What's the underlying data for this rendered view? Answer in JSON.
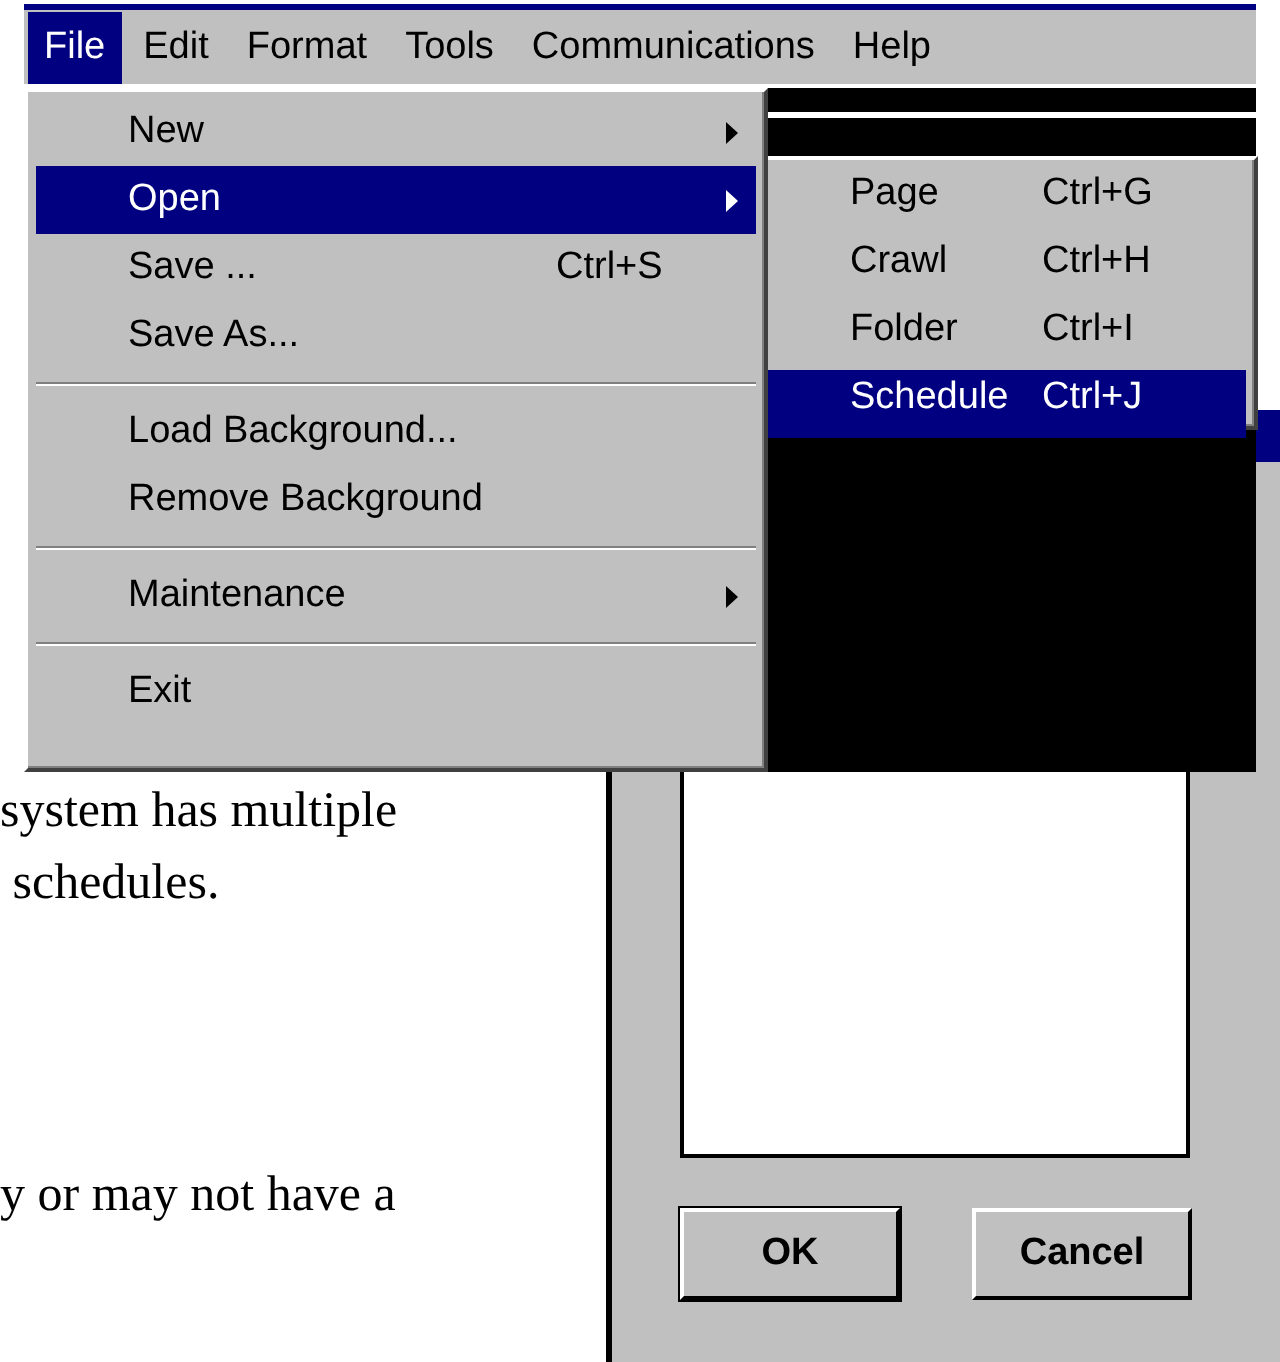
{
  "menu_bar": {
    "items": [
      {
        "label": "File",
        "selected": true
      },
      {
        "label": "Edit",
        "selected": false
      },
      {
        "label": "Format",
        "selected": false
      },
      {
        "label": "Tools",
        "selected": false
      },
      {
        "label": "Communications",
        "selected": false
      },
      {
        "label": "Help",
        "selected": false
      }
    ]
  },
  "file_menu": {
    "items": [
      {
        "kind": "item",
        "label": "New",
        "has_submenu": true,
        "selected": false
      },
      {
        "kind": "item",
        "label": "Open",
        "has_submenu": true,
        "selected": true
      },
      {
        "kind": "item",
        "label": "Save ...",
        "shortcut": "Ctrl+S",
        "has_submenu": false,
        "selected": false
      },
      {
        "kind": "item",
        "label": "Save As...",
        "has_submenu": false,
        "selected": false
      },
      {
        "kind": "separator"
      },
      {
        "kind": "item",
        "label": "Load Background...",
        "has_submenu": false,
        "selected": false
      },
      {
        "kind": "item",
        "label": "Remove Background",
        "has_submenu": false,
        "selected": false
      },
      {
        "kind": "separator"
      },
      {
        "kind": "item",
        "label": "Maintenance",
        "has_submenu": true,
        "selected": false
      },
      {
        "kind": "separator"
      },
      {
        "kind": "item",
        "label": "Exit",
        "has_submenu": false,
        "selected": false
      }
    ]
  },
  "open_submenu": {
    "items": [
      {
        "kind": "item",
        "label": "Page",
        "shortcut": "Ctrl+G",
        "has_submenu": false,
        "selected": false
      },
      {
        "kind": "item",
        "label": "Crawl",
        "shortcut": "Ctrl+H",
        "has_submenu": false,
        "selected": false
      },
      {
        "kind": "item",
        "label": "Folder",
        "shortcut": "Ctrl+I",
        "has_submenu": false,
        "selected": false
      },
      {
        "kind": "item",
        "label": "Schedule",
        "shortcut": "Ctrl+J",
        "has_submenu": false,
        "selected": true
      }
    ]
  },
  "document": {
    "lines": [
      "system has multiple",
      " schedules.",
      "y or may not have a"
    ]
  },
  "dialog": {
    "buttons": [
      {
        "label": "OK"
      },
      {
        "label": "Cancel"
      }
    ]
  }
}
